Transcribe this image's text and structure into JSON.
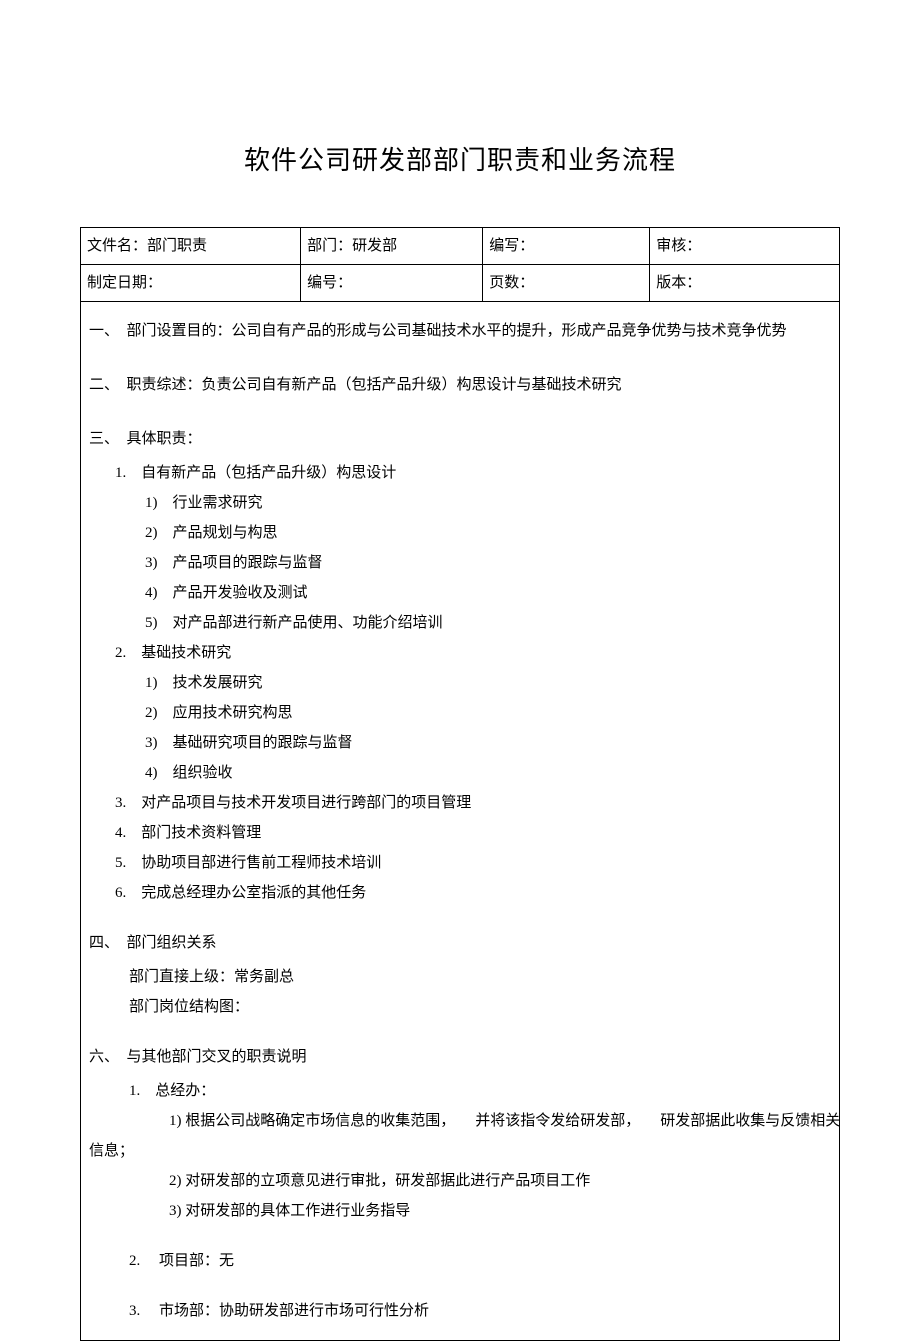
{
  "title": "软件公司研发部部门职责和业务流程",
  "header": {
    "filename_label": "文件名：部门职责",
    "dept_label": "部门：研发部",
    "writer_label": "编写：",
    "reviewer_label": "审核：",
    "date_label": "制定日期：",
    "no_label": "编号：",
    "pages_label": "页数：",
    "version_label": "版本："
  },
  "sec1": {
    "heading": "一、　部门设置目的：公司自有产品的形成与公司基础技术水平的提升，形成产品竞争优势与技术竞争优势"
  },
  "sec2": {
    "heading": "二、　职责综述：负责公司自有新产品（包括产品升级）构思设计与基础技术研究"
  },
  "sec3": {
    "heading": "三、　具体职责：",
    "item1": {
      "label": "1.　自有新产品（包括产品升级）构思设计",
      "s1": "1)　行业需求研究",
      "s2": "2)　产品规划与构思",
      "s3": "3)　产品项目的跟踪与监督",
      "s4": "4)　产品开发验收及测试",
      "s5": "5)　对产品部进行新产品使用、功能介绍培训"
    },
    "item2": {
      "label": "2.　基础技术研究",
      "s1": "1)　技术发展研究",
      "s2": "2)　应用技术研究构思",
      "s3": "3)　基础研究项目的跟踪与监督",
      "s4": "4)　组织验收"
    },
    "item3": "3.　对产品项目与技术开发项目进行跨部门的项目管理",
    "item4": "4.　部门技术资料管理",
    "item5": "5.　协助项目部进行售前工程师技术培训",
    "item6": "6.　完成总经理办公室指派的其他任务"
  },
  "sec4": {
    "heading": "四、　部门组织关系",
    "line1": "部门直接上级：常务副总",
    "line2": "部门岗位结构图："
  },
  "sec6": {
    "heading": "六、　与其他部门交叉的职责说明",
    "item1": {
      "label": "1.　总经办：",
      "s1a": "1)  根据公司战略确定市场信息的收集范围，",
      "s1b": "并将该指令发给研发部，",
      "s1c": "研发部据此收集与反馈相关",
      "s1d": "信息；",
      "s2": "2)  对研发部的立项意见进行审批，研发部据此进行产品项目工作",
      "s3": "3)  对研发部的具体工作进行业务指导"
    },
    "item2": "2. 　项目部：无",
    "item3": "3. 　市场部：协助研发部进行市场可行性分析"
  }
}
